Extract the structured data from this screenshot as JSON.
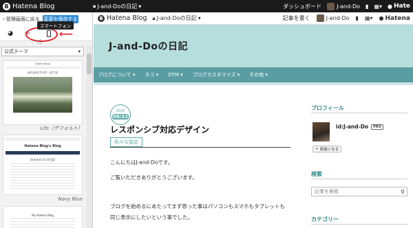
{
  "topbar": {
    "logo_text": "Hatena Blog",
    "blog_name": "J-and-Doの日記",
    "dashboard": "ダッシュボード",
    "user": "J-and-Do",
    "hatena": "Hate"
  },
  "editor": {
    "back_label": "管理画面に戻る",
    "save_label": "変更を保存する",
    "tooltip": "スマートフォン",
    "theme_select": "公式テーマ",
    "themes": [
      {
        "name": "Life（デフォルト）"
      },
      {
        "name": "Navy Blue"
      }
    ],
    "thumb1": {
      "title": "Hatena Blog",
      "heading": "みたまのブログ・はてな"
    },
    "thumb2": {
      "title": "Hatena Blog's Blog",
      "heading": "ゆるゆるブログ日記"
    },
    "thumb3": {
      "title": "My Hatena Blog"
    }
  },
  "preview": {
    "logo_text": "Hatena Blog",
    "blog_name": "J-and-Doの日記",
    "write_post": "記事を書く",
    "user": "J-and-Do",
    "hatena": "Hatena",
    "blog_title": "J-and-Doの日記",
    "nav": [
      "ブログについて",
      "ネコ",
      "DTM",
      "ブログカスタマイズ",
      "その他"
    ],
    "date_year": "2016",
    "date_md": "08/22",
    "post_title": "レスポンシブ対応デザイン",
    "category": "色々な設定",
    "paragraphs": [
      "こんにちはJ-and-Doです。",
      "ご覧いただきありがとうございます。",
      "ブログを始めるにあたってまず思った事はパソコンもスマホもタブレットも",
      "同じ表示にしたいという事でした。"
    ],
    "sidebar": {
      "profile_heading": "プロフィール",
      "profile_id": "id:J-and-Do",
      "pro": "PRO",
      "follow": "読者になる",
      "search_heading": "検索",
      "search_placeholder": "記事を検索",
      "category_heading": "カテゴリー"
    }
  }
}
